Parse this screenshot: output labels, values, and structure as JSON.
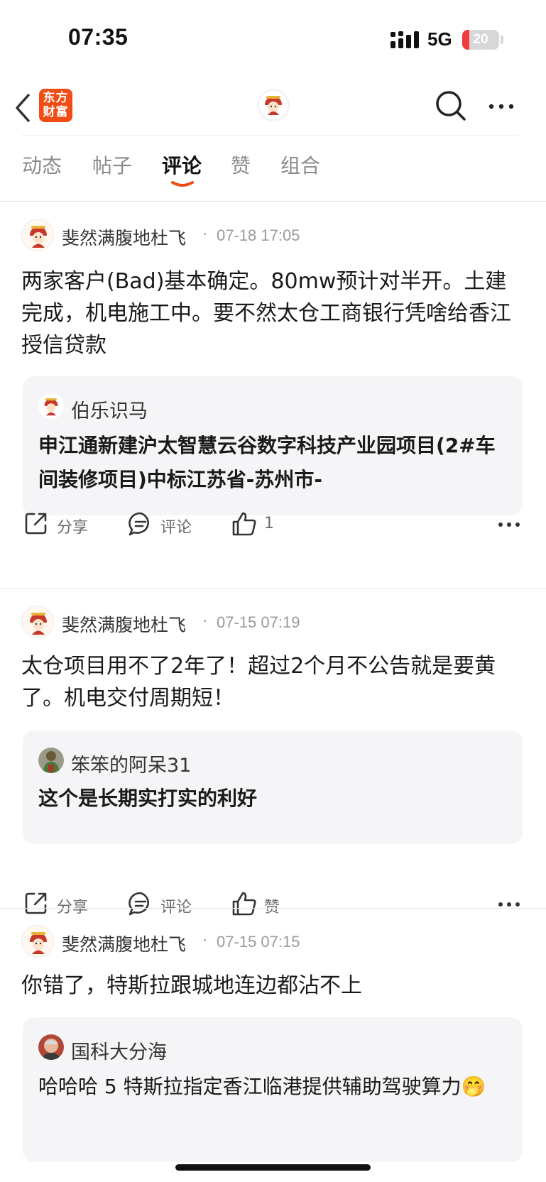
{
  "status_bar": {
    "time": "07:35",
    "network": "5G",
    "battery_level": "20",
    "battery_fraction": 0.2,
    "icons": [
      "signal-icon",
      "battery-icon"
    ]
  },
  "nav": {
    "logo_line1": "东方",
    "logo_line2": "财富",
    "icons": [
      "back-icon",
      "avatar",
      "search-icon",
      "more-icon"
    ],
    "accent_color": "#f04c16"
  },
  "tabs": [
    {
      "label": "动态",
      "active": false
    },
    {
      "label": "帖子",
      "active": false
    },
    {
      "label": "评论",
      "active": true
    },
    {
      "label": "赞",
      "active": false
    },
    {
      "label": "组合",
      "active": false
    }
  ],
  "comments": [
    {
      "username": "斐然满腹地杜飞",
      "separator": "·",
      "timestamp": "07-18 17:05",
      "text": "两家客户(Bad)基本确定。80mw预计对半开。土建完成，机电施工中。要不然太仓工商银行凭啥给香江授信贷款",
      "quote": {
        "author": "伯乐识马",
        "text": "申江通新建沪太智慧云谷数字科技产业园项目(2#车间装修项目)中标江苏省-苏州市-"
      },
      "actions": {
        "share": "分享",
        "comment": "评论",
        "like": "1"
      }
    },
    {
      "username": "斐然满腹地杜飞",
      "separator": "·",
      "timestamp": "07-15 07:19",
      "text": "太仓项目用不了2年了！超过2个月不公告就是要黄了。机电交付周期短！",
      "quote": {
        "author": "笨笨的阿呆31",
        "text": "这个是长期实打实的利好"
      },
      "actions": {
        "share": "分享",
        "comment": "评论",
        "like": "赞"
      }
    },
    {
      "username": "斐然满腹地杜飞",
      "separator": "·",
      "timestamp": "07-15 07:15",
      "text": "你错了，特斯拉跟城地连边都沾不上",
      "quote": {
        "author": "国科大分海",
        "text": "哈哈哈 5 特斯拉指定香江临港提供辅助驾驶算力",
        "emoji": "🤭"
      }
    }
  ]
}
